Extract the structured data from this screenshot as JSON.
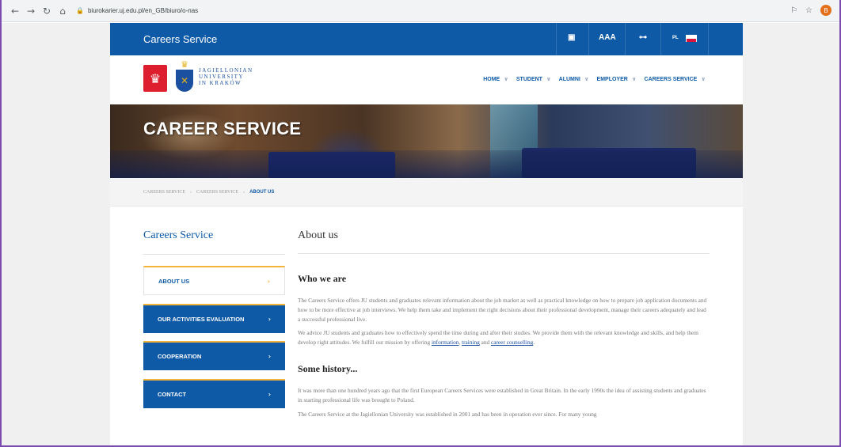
{
  "browser": {
    "url": "biurokarier.uj.edu.pl/en_GB/biuro/o-nas",
    "profile_initial": "B"
  },
  "topbar": {
    "brand": "Careers Service",
    "font_size_label": "AAA",
    "lang": "PL"
  },
  "university": {
    "line1": "JAGIELLONIAN",
    "line2": "UNIVERSITY",
    "line3": "IN KRAKÓW"
  },
  "nav": [
    "HOME",
    "STUDENT",
    "ALUMNI",
    "EMPLOYER",
    "CAREERS SERVICE"
  ],
  "hero": {
    "title": "CAREER SERVICE"
  },
  "breadcrumb": [
    "CAREERS SERVICE",
    "CAREERS SERVICE",
    "ABOUT US"
  ],
  "sidebar": {
    "title": "Careers Service",
    "items": [
      {
        "label": "ABOUT US",
        "active": true
      },
      {
        "label": "OUR ACTIVITIES EVALUATION"
      },
      {
        "label": "COOPERATION"
      },
      {
        "label": "CONTACT"
      }
    ]
  },
  "content": {
    "title": "About us",
    "section1_heading": "Who we are",
    "p1": "The Careers Service offers JU students and graduates  relevant information about the job market as well as practical knowledge on how to prepare job application documents and how to be more effective at job interviews. We help them take and implement the right decisions about their professional development, manage their careers adequately and lead a successful professional live.",
    "p2_text": "We advice JU students and graduates how to effectively spend the time during and after their studies. We provide them with the relevant knowledge and skills, and help them develop right attitudes. We fulfill our mission by offering ",
    "p2_link1": "information",
    "p2_comma": ", ",
    "p2_link2": "training",
    "p2_and": " and ",
    "p2_link3": "career counselling",
    "p2_end": ".",
    "section2_heading": "Some history...",
    "p3": "It was more than one hundred years ago that the first European Careers Services were established in Great Britain. In the early 1990s the idea of  assisting students and graduates in starting professional life was brought to Poland.",
    "p4": "The Careers Service at the Jagiellonian University was established in 2001 and has been in operation ever since. For many young"
  },
  "colors": {
    "brand_blue": "#0e5aa7",
    "accent_gold": "#f2b53a"
  }
}
